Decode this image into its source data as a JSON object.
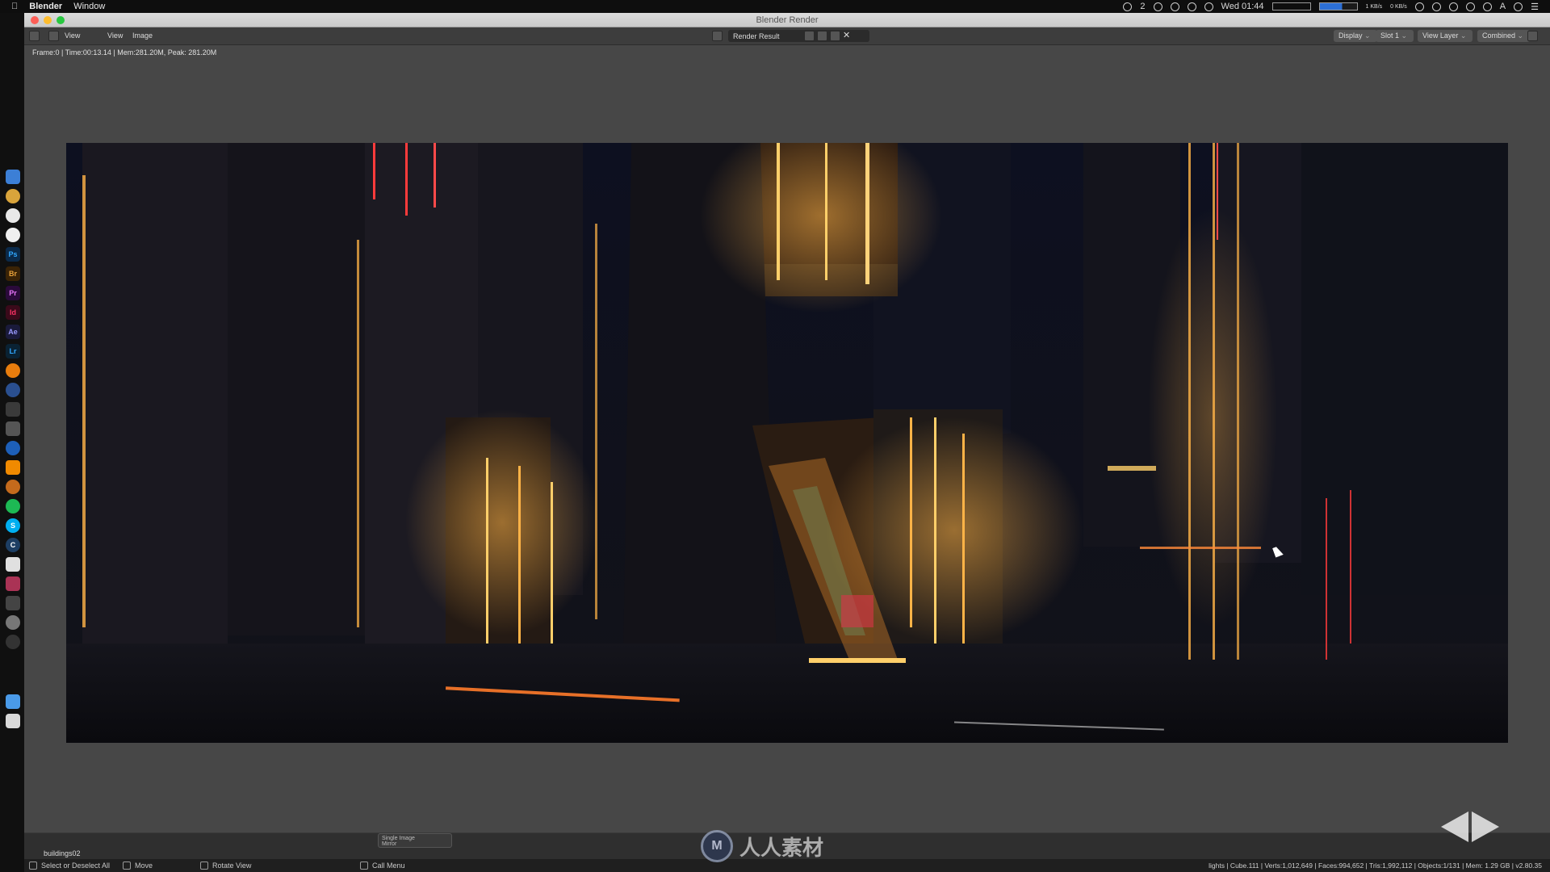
{
  "menubar": {
    "app_name": "Blender",
    "menu_window": "Window",
    "clock": "Wed 01:44",
    "notif_count": "2",
    "net_rate_up": "1 KB/s",
    "net_rate_down": "0 KB/s",
    "input_label": "A"
  },
  "window": {
    "title": "Blender Render"
  },
  "header": {
    "menus": [
      "View",
      "View",
      "Image"
    ],
    "image_name": "Render Result",
    "display_label": "Display",
    "slot_label": "Slot 1",
    "view_layer_label": "View Layer",
    "pass_label": "Combined"
  },
  "render_info": "Frame:0 | Time:00:13.14 | Mem:281.20M, Peak: 281.20M",
  "bottom": {
    "object_name": "buildings02",
    "popup_line1": "Single Image",
    "popup_line2": "Mirror"
  },
  "footer": {
    "select_label": "Select or Deselect All",
    "move_label": "Move",
    "rotate_label": "Rotate View",
    "call_menu_label": "Call Menu",
    "stats": "lights | Cube.111 | Verts:1,012,649 | Faces:994,652 | Tris:1,992,112 | Objects:1/131 | Mem: 1.29 GB | v2.80.35"
  },
  "watermark": {
    "brand_text": "人人素材",
    "brand_logo_letter": "M"
  },
  "dock": {
    "apps": [
      "Finder",
      "Chrome",
      "Safari",
      "Reminders",
      "Ps",
      "Br",
      "Pr",
      "Id",
      "Ae",
      "Lr",
      "Blender",
      "Cinema4D",
      "Xcode",
      "Spotify",
      "Skype",
      "Trash"
    ]
  },
  "colors": {
    "accent_orange": "#ffb347",
    "neon_red": "#ff3b3b",
    "viewport_bg": "#474747"
  }
}
